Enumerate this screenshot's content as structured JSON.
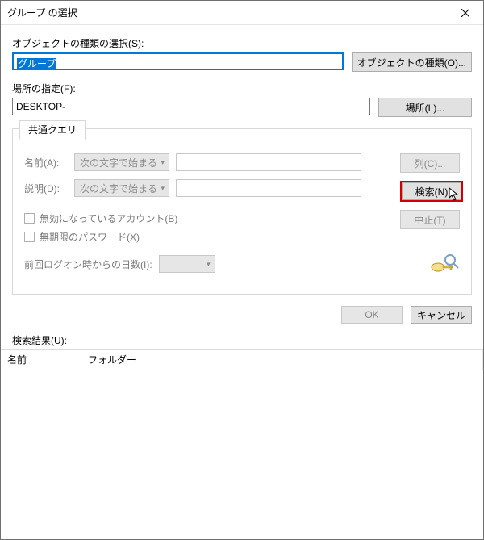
{
  "title": "グループ の選択",
  "object_type": {
    "label": "オブジェクトの種類の選択(S):",
    "value": "グループ",
    "button": "オブジェクトの種類(O)..."
  },
  "location": {
    "label": "場所の指定(F):",
    "value": "DESKTOP-",
    "button": "場所(L)..."
  },
  "query": {
    "tab": "共通クエリ",
    "name_label": "名前(A):",
    "desc_label": "説明(D):",
    "starts_with": "次の文字で始まる",
    "name_value": "",
    "desc_value": "",
    "chk_disabled_accounts": "無効になっているアカウント(B)",
    "chk_nonexpiring_pw": "無期限のパスワード(X)",
    "days_label": "前回ログオン時からの日数(I):",
    "days_value": "",
    "btn_columns": "列(C)...",
    "btn_search": "検索(N)",
    "btn_stop": "中止(T)"
  },
  "footer": {
    "ok": "OK",
    "cancel": "キャンセル"
  },
  "results": {
    "label": "検索結果(U):",
    "col_name": "名前",
    "col_folder": "フォルダー"
  }
}
